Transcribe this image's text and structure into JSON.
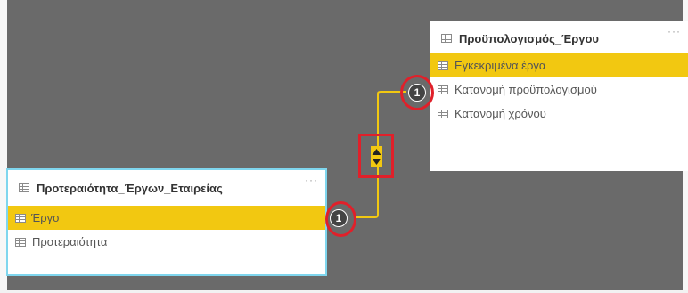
{
  "tables": {
    "budget": {
      "title": "Προϋπολογισμός_Έργου",
      "more": "···",
      "fields": [
        {
          "label": "Εγκεκριμένα έργα",
          "highlighted": true
        },
        {
          "label": "Κατανομή προϋπολογισμού",
          "highlighted": false
        },
        {
          "label": "Κατανομή χρόνου",
          "highlighted": false
        }
      ]
    },
    "priority": {
      "title": "Προτεραιότητα_Έργων_Εταιρείας",
      "more": "···",
      "fields": [
        {
          "label": "Έργο",
          "highlighted": true
        },
        {
          "label": "Προτεραιότητα",
          "highlighted": false
        }
      ]
    }
  },
  "relationship": {
    "left_cardinality": "1",
    "right_cardinality": "1",
    "cross_filter": "both",
    "line_color": "#f2c811",
    "highlight_color": "#e0202a"
  },
  "colors": {
    "canvas": "#6a6a6a",
    "field_highlight": "#f2c811",
    "selected_border": "#7fd6ee"
  },
  "icons": {
    "table": "table-icon",
    "more": "ellipsis-icon",
    "cross_filter": "bidirectional-arrows-icon"
  }
}
